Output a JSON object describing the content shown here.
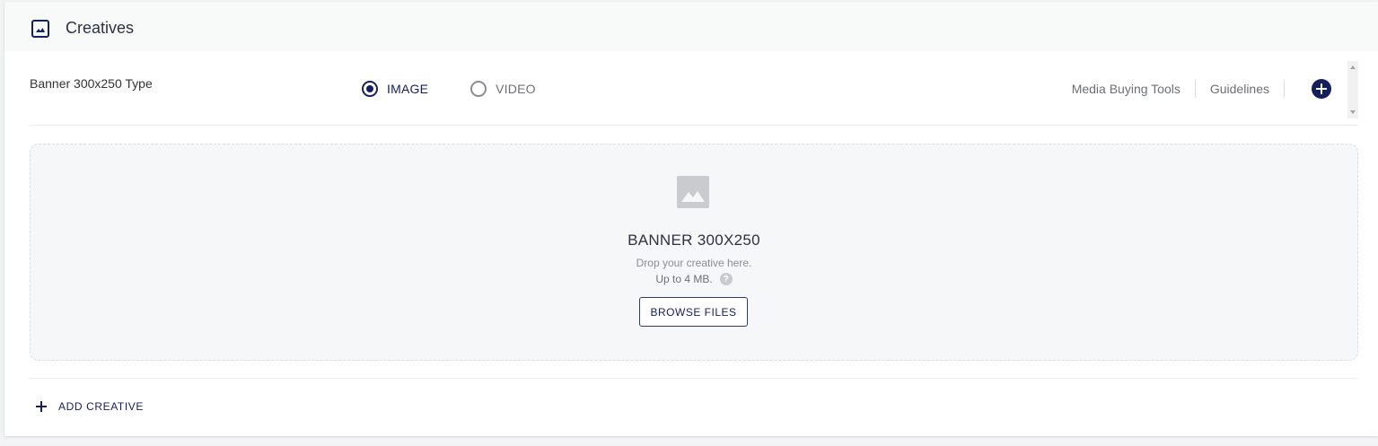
{
  "header": {
    "icon": "image-icon",
    "title": "Creatives"
  },
  "type_row": {
    "label": "Banner 300x250 Type",
    "options": [
      {
        "label": "IMAGE",
        "selected": true
      },
      {
        "label": "VIDEO",
        "selected": false
      }
    ],
    "links": {
      "media_buying_tools": "Media Buying Tools",
      "guidelines": "Guidelines"
    },
    "add_icon": "plus-circle-icon"
  },
  "dropzone": {
    "icon": "image-placeholder-icon",
    "title": "BANNER 300X250",
    "hint": "Drop your creative here.",
    "size_limit": "Up to 4 MB.",
    "help_glyph": "?",
    "browse_label": "BROWSE FILES"
  },
  "footer": {
    "add_creative_label": "ADD CREATIVE"
  },
  "colors": {
    "accent": "#14205e",
    "header_bg": "#f7faf9",
    "dropzone_bg": "#f6f7f9",
    "muted_text": "#6c6f75"
  }
}
